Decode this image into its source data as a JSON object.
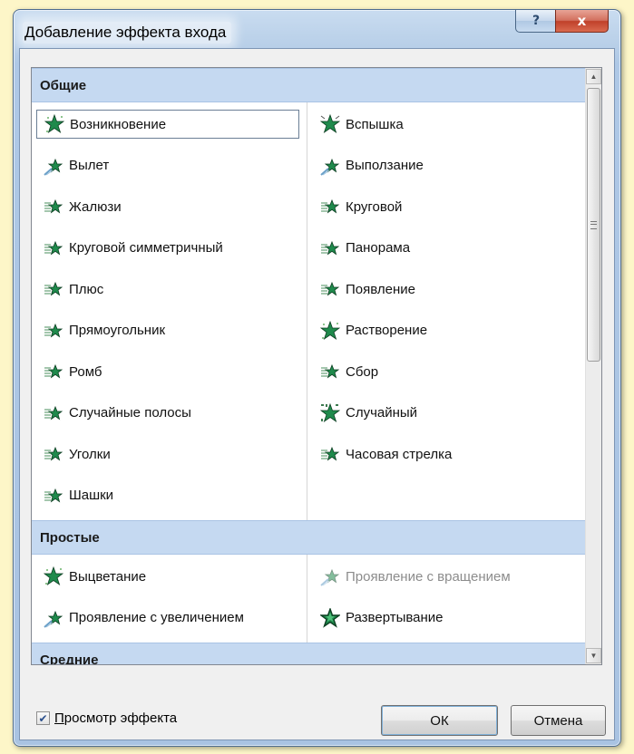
{
  "window": {
    "title": "Добавление эффекта входа",
    "help_label": "?",
    "close_label": "x"
  },
  "groups": [
    {
      "name": "Общие",
      "items": [
        {
          "label": "Возникновение",
          "icon": "star-appear-icon",
          "selected": true
        },
        {
          "label": "Вспышка",
          "icon": "star-flash-icon"
        },
        {
          "label": "Вылет",
          "icon": "star-fly-icon"
        },
        {
          "label": "Выползание",
          "icon": "star-fly-icon"
        },
        {
          "label": "Жалюзи",
          "icon": "star-stripes-icon"
        },
        {
          "label": "Круговой",
          "icon": "star-stripes-icon"
        },
        {
          "label": "Круговой симметричный",
          "icon": "star-stripes-icon"
        },
        {
          "label": "Панорама",
          "icon": "star-stripes-icon"
        },
        {
          "label": "Плюс",
          "icon": "star-stripes-icon"
        },
        {
          "label": "Появление",
          "icon": "star-stripes-icon"
        },
        {
          "label": "Прямоугольник",
          "icon": "star-stripes-icon"
        },
        {
          "label": "Растворение",
          "icon": "star-appear-icon"
        },
        {
          "label": "Ромб",
          "icon": "star-stripes-icon"
        },
        {
          "label": "Сбор",
          "icon": "star-stripes-icon"
        },
        {
          "label": "Случайные полосы",
          "icon": "star-stripes-icon"
        },
        {
          "label": "Случайный",
          "icon": "star-random-icon"
        },
        {
          "label": "Уголки",
          "icon": "star-stripes-icon"
        },
        {
          "label": "Часовая стрелка",
          "icon": "star-stripes-icon"
        },
        {
          "label": "Шашки",
          "icon": "star-stripes-icon"
        }
      ]
    },
    {
      "name": "Простые",
      "items": [
        {
          "label": "Выцветание",
          "icon": "star-appear-icon"
        },
        {
          "label": "Проявление с вращением",
          "icon": "star-fly-icon",
          "disabled": true
        },
        {
          "label": "Проявление с увеличением",
          "icon": "star-fly-icon"
        },
        {
          "label": "Развертывание",
          "icon": "star-expand-icon"
        }
      ]
    },
    {
      "name": "Средние",
      "items": []
    }
  ],
  "footer": {
    "preview_checked": true,
    "preview_label_underlined": "П",
    "preview_label_rest": "росмотр эффекта",
    "ok_label": "ОК",
    "cancel_label": "Отмена"
  },
  "colors": {
    "accent": "#c5d9f1",
    "icon_green": "#1f8a4c",
    "page_background": "#fdf6c8"
  }
}
